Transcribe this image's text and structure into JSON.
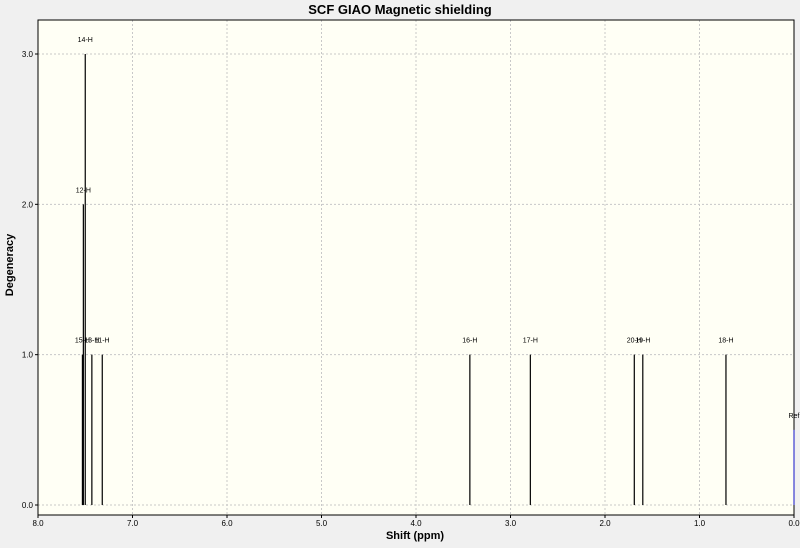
{
  "chart_data": {
    "type": "line",
    "title": "SCF GIAO Magnetic shielding",
    "xlabel": "Shift (ppm)",
    "ylabel": "Degeneracy",
    "xlim": [
      8.0,
      0.0
    ],
    "ylim": [
      0.0,
      3.0
    ],
    "x_reversed": true,
    "grid": true,
    "x_ticks": [
      "8.0",
      "7.0",
      "6.0",
      "5.0",
      "4.0",
      "3.0",
      "2.0",
      "1.0",
      "0.0"
    ],
    "y_ticks": [
      "0.0",
      "1.0",
      "2.0",
      "3.0"
    ],
    "colors": {
      "plot_bg": "#fffff5",
      "page_bg": "#f0f0f0",
      "grid": "#c8c8c8",
      "peak": "#000000",
      "ref": "#3a3ad0"
    },
    "series": [
      {
        "peaks": [
          {
            "x": 7.5,
            "y": 3.0,
            "label": "14-H"
          },
          {
            "x": 7.52,
            "y": 2.0,
            "label": "12-H"
          },
          {
            "x": 7.53,
            "y": 1.0,
            "label": "15-H"
          },
          {
            "x": 7.43,
            "y": 1.0,
            "label": "13-H"
          },
          {
            "x": 7.32,
            "y": 1.0,
            "label": "11-H"
          },
          {
            "x": 3.43,
            "y": 1.0,
            "label": "16-H"
          },
          {
            "x": 2.79,
            "y": 1.0,
            "label": "17-H"
          },
          {
            "x": 1.69,
            "y": 1.0,
            "label": "20-H"
          },
          {
            "x": 1.6,
            "y": 1.0,
            "label": "19-H"
          },
          {
            "x": 0.72,
            "y": 1.0,
            "label": "18-H"
          }
        ]
      },
      {
        "peaks": [
          {
            "x": 0.0,
            "y": 0.5,
            "label": "Ref"
          }
        ]
      }
    ]
  }
}
